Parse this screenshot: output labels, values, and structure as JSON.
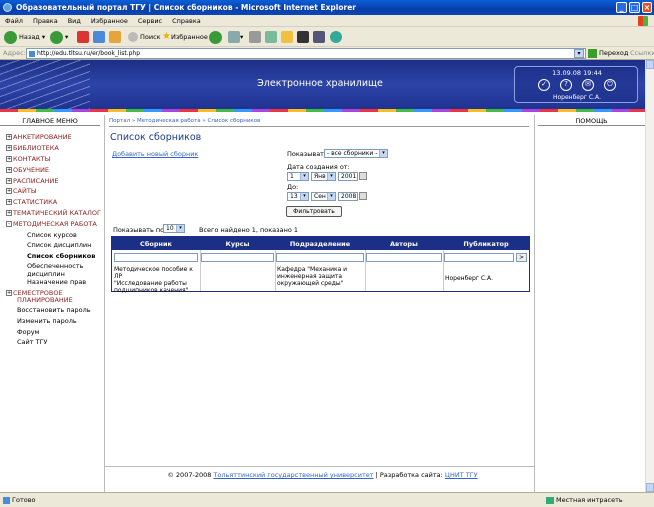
{
  "window": {
    "title": "Образовательный портал ТГУ | Список сборников - Microsoft Internet Explorer"
  },
  "menubar": [
    "Файл",
    "Правка",
    "Вид",
    "Избранное",
    "Сервис",
    "Справка"
  ],
  "toolbar": {
    "back": "Назад",
    "search": "Поиск",
    "favorites": "Избранное"
  },
  "address": {
    "label": "Адрес:",
    "url": "http://edu.tltsu.ru/er/book_list.php",
    "go": "Переход",
    "links": "Ссылки"
  },
  "header": {
    "title": "Электронное хранилище",
    "datetime": "13.09.08 19:44",
    "user": "Норенберг С.А.",
    "icons": [
      "check-icon",
      "help-icon",
      "mail-icon",
      "power-icon"
    ]
  },
  "left_menu": {
    "heading": "ГЛАВНОЕ МЕНЮ",
    "items": [
      {
        "label": "АНКЕТИРОВАНИЕ",
        "sign": "+"
      },
      {
        "label": "БИБЛИОТЕКА",
        "sign": "+"
      },
      {
        "label": "КОНТАКТЫ",
        "sign": "+"
      },
      {
        "label": "ОБУЧЕНИЕ",
        "sign": "+"
      },
      {
        "label": "РАСПИСАНИЕ",
        "sign": "+"
      },
      {
        "label": "САЙТЫ",
        "sign": "+"
      },
      {
        "label": "СТАТИСТИКА",
        "sign": "+"
      },
      {
        "label": "ТЕМАТИЧЕСКИЙ КАТАЛОГ",
        "sign": "+"
      },
      {
        "label": "МЕТОДИЧЕСКАЯ РАБОТА",
        "sign": "-"
      }
    ],
    "subitems": [
      "Список курсов",
      "Список дисциплин",
      "Список сборников",
      "Обеспеченность",
      "дисциплин",
      "Назначение прав"
    ],
    "semester": [
      "СЕМЕСТРОВОЕ",
      "ПЛАНИРОВАНИЕ"
    ],
    "plain": [
      "Восстановить пароль",
      "Изменить пароль",
      "Форум",
      "Сайт ТГУ"
    ]
  },
  "right_menu": {
    "heading": "ПОМОЩЬ"
  },
  "breadcrumb": "Портал » Методическая работа » Список сборников",
  "page": {
    "title": "Список сборников",
    "add_link": "Добавить новый сборник"
  },
  "filter": {
    "show_label": "Показывать:",
    "show_value": "- все сборники -",
    "date_from_label": "Дата создания от:",
    "from_day": "1",
    "from_month": "Янв",
    "from_year": "2001",
    "date_to_label": "До:",
    "to_day": "13",
    "to_month": "Сен",
    "to_year": "2008",
    "button": "Фильтровать"
  },
  "paging": {
    "show_label": "Показывать по",
    "per_page": "10",
    "found": "Всего найдено 1, показано 1"
  },
  "table": {
    "columns": [
      "Сборник",
      "Курсы",
      "Подразделение",
      "Авторы",
      "Публикатор"
    ],
    "filter_go": ">",
    "rows": [
      {
        "book": [
          "Методическое пособие к ЛР",
          "\"Исследование работы",
          "подшипников качения\""
        ],
        "courses": "",
        "department": [
          "Кафедра \"Механика и",
          "инженерная защита",
          "окружающей среды\""
        ],
        "authors": "",
        "publisher": "Норенберг С.А."
      }
    ]
  },
  "footer": {
    "copyright": "© 2007-2008",
    "university": "Тольяттинский государственный университет",
    "dev_label": "| Разработка сайта:",
    "dev": "ЦНИТ ТГУ"
  },
  "status": {
    "text": "Готово",
    "zone": "Местная интрасеть"
  }
}
